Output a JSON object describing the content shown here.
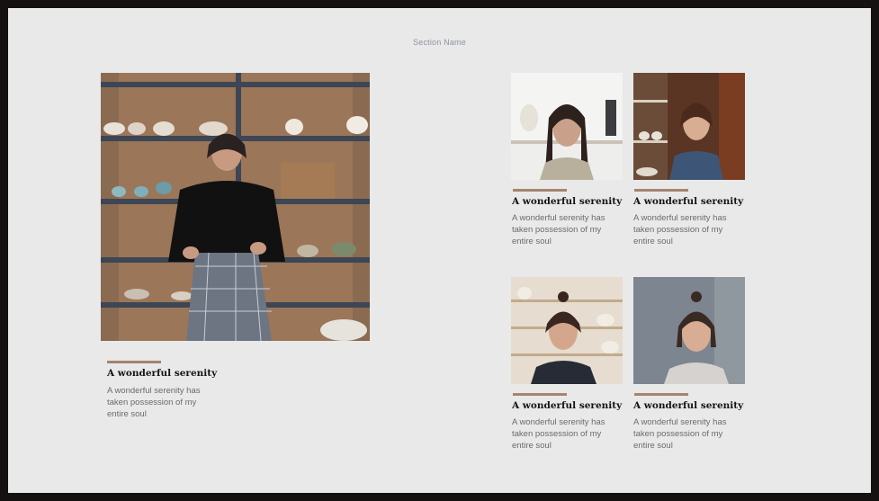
{
  "section": {
    "name": "Section Name"
  },
  "accent_color": "#a58470",
  "cards": [
    {
      "title": "A wonderful serenity",
      "text": "A wonderful serenity has taken possession of my entire soul",
      "photo_alt": "portrait-photo"
    },
    {
      "title": "A wonderful serenity",
      "text": "A wonderful serenity has taken possession of my entire soul",
      "photo_alt": "portrait-photo"
    },
    {
      "title": "A wonderful serenity",
      "text": "A wonderful serenity has taken possession of my entire soul",
      "photo_alt": "portrait-photo"
    },
    {
      "title": "A wonderful serenity",
      "text": "A wonderful serenity has taken possession of my entire soul",
      "photo_alt": "portrait-photo"
    },
    {
      "title": "A wonderful serenity",
      "text": "A wonderful serenity has taken possession of my entire soul",
      "photo_alt": "portrait-photo"
    }
  ]
}
